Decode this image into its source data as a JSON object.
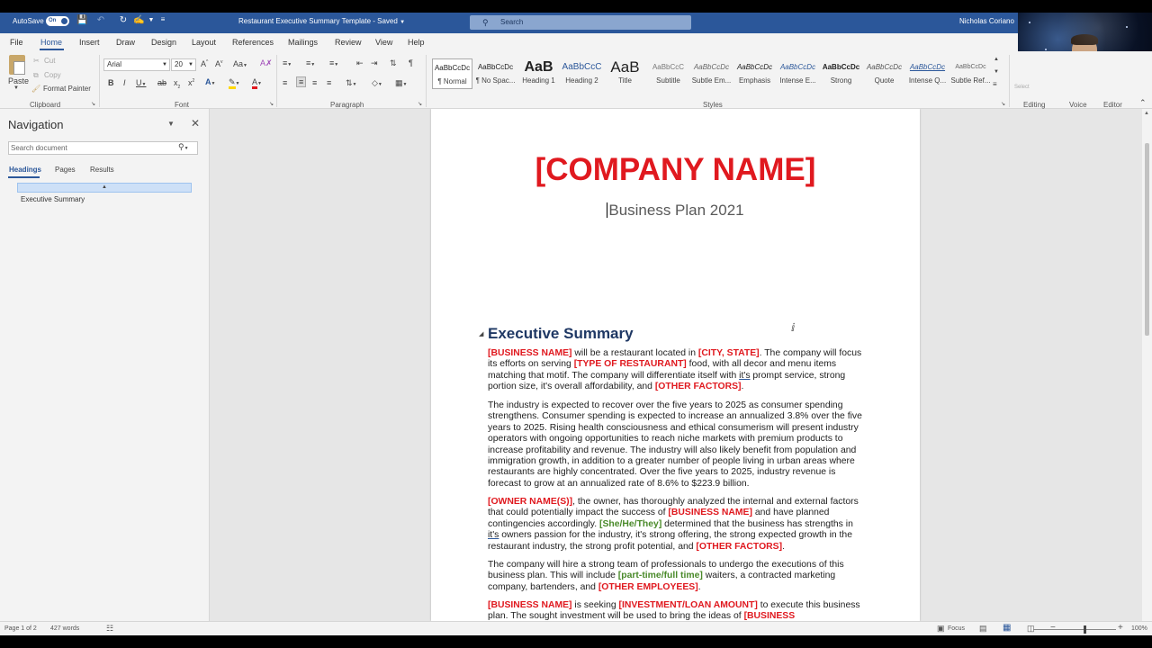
{
  "titlebar": {
    "autosave_label": "AutoSave",
    "autosave_state": "On",
    "doc_title": "Restaurant Executive Summary Template - Saved",
    "search_placeholder": "Search",
    "user_name": "Nicholas Coriano"
  },
  "menu": {
    "tabs": [
      "File",
      "Home",
      "Insert",
      "Draw",
      "Design",
      "Layout",
      "References",
      "Mailings",
      "Review",
      "View",
      "Help"
    ],
    "active_tab": "Home"
  },
  "ribbon": {
    "clipboard": {
      "paste": "Paste",
      "cut": "Cut",
      "copy": "Copy",
      "format_painter": "Format Painter",
      "label": "Clipboard"
    },
    "font": {
      "font_name": "Arial",
      "font_size": "20",
      "label": "Font"
    },
    "paragraph": {
      "label": "Paragraph"
    },
    "styles": {
      "label": "Styles",
      "items": [
        {
          "sample": "AaBbCcDc",
          "name": "¶ Normal"
        },
        {
          "sample": "AaBbCcDc",
          "name": "¶ No Spac..."
        },
        {
          "sample": "AaB",
          "name": "Heading 1"
        },
        {
          "sample": "AaBbCcC",
          "name": "Heading 2"
        },
        {
          "sample": "AaB",
          "name": "Title"
        },
        {
          "sample": "AaBbCcC",
          "name": "Subtitle"
        },
        {
          "sample": "AaBbCcDc",
          "name": "Subtle Em..."
        },
        {
          "sample": "AaBbCcDc",
          "name": "Emphasis"
        },
        {
          "sample": "AaBbCcDc",
          "name": "Intense E..."
        },
        {
          "sample": "AaBbCcDc",
          "name": "Strong"
        },
        {
          "sample": "AaBbCcDc",
          "name": "Quote"
        },
        {
          "sample": "AaBbCcDc",
          "name": "Intense Q..."
        },
        {
          "sample": "AaBbCcDc",
          "name": "Subtle Ref..."
        }
      ]
    },
    "editing": {
      "label": "Editing",
      "select": "Select"
    },
    "voice": {
      "label": "Voice"
    },
    "editor": {
      "label": "Editor"
    }
  },
  "navigation": {
    "title": "Navigation",
    "search_placeholder": "Search document",
    "tabs": [
      "Headings",
      "Pages",
      "Results"
    ],
    "active_tab": "Headings",
    "headings": [
      "Executive Summary"
    ]
  },
  "document": {
    "company_name": "[COMPANY NAME]",
    "subtitle": "Business Plan 2021",
    "section_heading": "Executive Summary",
    "p1": {
      "s1": "[BUSINESS NAME]",
      "t1": " will be a restaurant located in ",
      "s2": "[CITY, STATE]",
      "t2": ". The company will focus its efforts on serving ",
      "s3": "[TYPE OF RESTAURANT]",
      "t3": " food, with all decor and menu items matching that motif. The company will differentiate itself with ",
      "w1": "it's",
      "t4": " prompt service, strong portion size, it's overall affordability, and ",
      "s4": "[OTHER FACTORS]",
      "t5": "."
    },
    "p2": "The industry is expected to recover over the five years to 2025 as consumer spending strengthens. Consumer spending is expected to increase an annualized 3.8% over the five years to 2025. Rising health consciousness and ethical consumerism will present industry operators with ongoing opportunities to reach niche markets with premium products to increase profitability and revenue. The industry will also likely benefit from population and immigration growth, in addition to a greater number of people living in urban areas where restaurants are highly concentrated. Over the five years to 2025, industry revenue is forecast to grow at an annualized rate of 8.6% to $223.9 billion.",
    "p3": {
      "s1": "[OWNER NAME(S)]",
      "t1": ", the owner, has thoroughly analyzed the internal and external factors that could potentially impact the success of ",
      "s2": "[BUSINESS NAME]",
      "t2": " and have planned contingencies accordingly. ",
      "g1": "[She/He/They]",
      "t3": " determined that the business has strengths in ",
      "w1": "it's",
      "t4": " owners passion for the industry, it's strong offering, the strong expected growth in the restaurant industry, the strong profit potential, and ",
      "s3": "[OTHER FACTORS]",
      "t5": "."
    },
    "p4": {
      "t1": "The company will hire a strong team of professionals to undergo the executions of this business plan. This will include ",
      "g1": "[part-time/full time]",
      "t2": " waiters, a contracted marketing company, bartenders, and ",
      "s1": "[OTHER EMPLOYEES]",
      "t3": "."
    },
    "p5": {
      "s1": "[BUSINESS NAME]",
      "t1": " is seeking ",
      "s2": "[INVESTMENT/LOAN AMOUNT]",
      "t2": " to execute this business plan. The sought investment will be used to bring the ideas of ",
      "s3": "[BUSINESS"
    }
  },
  "statusbar": {
    "page": "Page 1 of 2",
    "words": "427 words",
    "focus": "Focus",
    "zoom": "100%"
  },
  "colors": {
    "accent": "#2b579a",
    "placeholder_red": "#e0191f",
    "placeholder_green": "#4a8a2a",
    "heading_blue": "#1f3864"
  }
}
